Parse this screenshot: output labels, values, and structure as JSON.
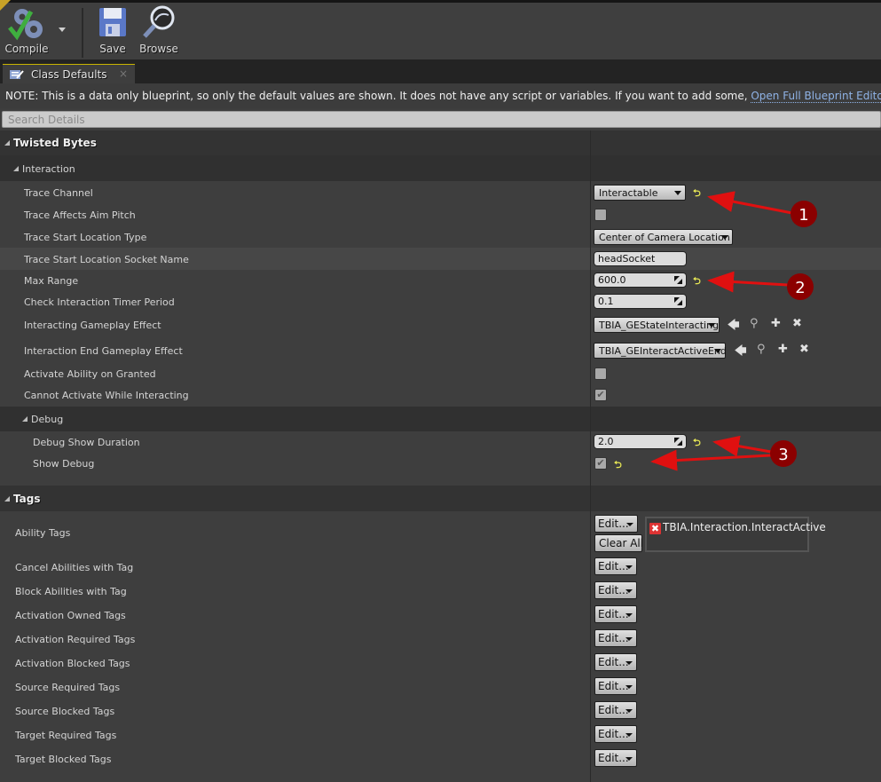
{
  "toolbar": {
    "compile_label": "Compile",
    "save_label": "Save",
    "browse_label": "Browse"
  },
  "tab": {
    "label": "Class Defaults",
    "close": "×"
  },
  "note": {
    "text": "NOTE: This is a data only blueprint, so only the default values are shown.  It does not have any script or variables.  If you want to add some, ",
    "link": "Open Full Blueprint Editor"
  },
  "search": {
    "placeholder": "Search Details"
  },
  "categories": {
    "twisted_bytes": "Twisted Bytes",
    "interaction": "Interaction",
    "debug": "Debug",
    "tags": "Tags"
  },
  "properties": {
    "trace_channel": {
      "label": "Trace Channel",
      "value": "Interactable"
    },
    "trace_affects_aim_pitch": {
      "label": "Trace Affects Aim Pitch",
      "checked": false
    },
    "trace_start_location_type": {
      "label": "Trace Start Location Type",
      "value": "Center of Camera Location"
    },
    "trace_start_socket": {
      "label": "Trace Start Location Socket Name",
      "value": "headSocket"
    },
    "max_range": {
      "label": "Max Range",
      "value": "600.0"
    },
    "check_timer": {
      "label": "Check Interaction Timer Period",
      "value": "0.1"
    },
    "interacting_ge": {
      "label": "Interacting Gameplay Effect",
      "value": "TBIA_GEStateInteracting"
    },
    "interaction_end_ge": {
      "label": "Interaction End Gameplay Effect",
      "value": "TBIA_GEInteractActiveEnd"
    },
    "activate_on_granted": {
      "label": "Activate Ability on Granted",
      "checked": false
    },
    "cannot_activate_while_interacting": {
      "label": "Cannot Activate While Interacting",
      "checked": true
    },
    "debug_show_duration": {
      "label": "Debug Show Duration",
      "value": "2.0"
    },
    "show_debug": {
      "label": "Show Debug",
      "checked": true
    }
  },
  "tags": {
    "edit_label": "Edit...",
    "clear_all_label": "Clear All",
    "ability_tags": {
      "label": "Ability Tags",
      "values": [
        "TBIA.Interaction.InteractActive"
      ]
    },
    "rows": [
      "Cancel Abilities with Tag",
      "Block Abilities with Tag",
      "Activation Owned Tags",
      "Activation Required Tags",
      "Activation Blocked Tags",
      "Source Required Tags",
      "Source Blocked Tags",
      "Target Required Tags",
      "Target Blocked Tags"
    ]
  },
  "glyphs": {
    "reset": "⮌",
    "check": "✔",
    "use_selected": "🡄",
    "browse": "⚲",
    "add": "✚",
    "clear": "✖",
    "remove_tag": "✖"
  },
  "annotations": [
    "1",
    "2",
    "3"
  ],
  "colors": {
    "accent_yellow": "#c8b400",
    "link_blue": "#8fb3e6",
    "annotation_red": "#e01010",
    "badge_dark_red": "#8b0000"
  }
}
